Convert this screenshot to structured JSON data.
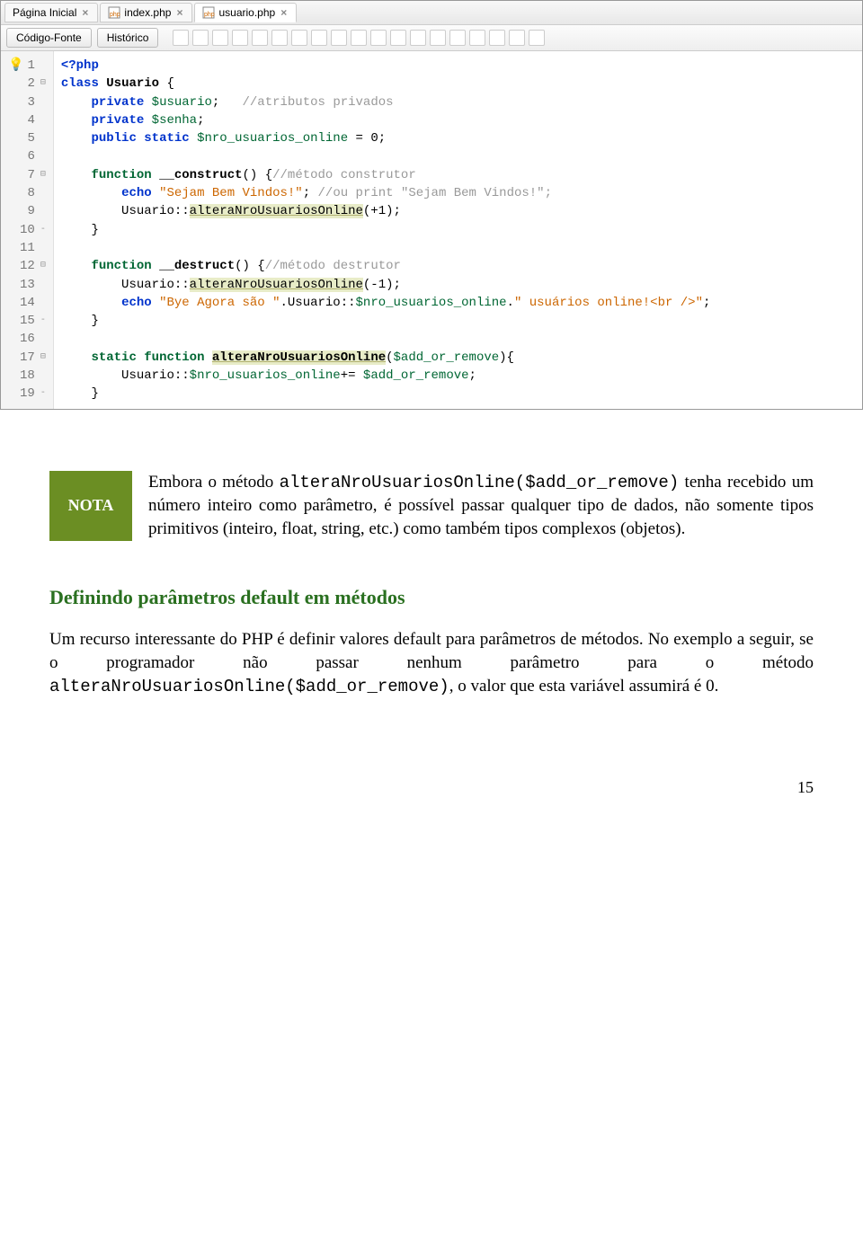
{
  "ide": {
    "tabs": [
      {
        "label": "Página Inicial"
      },
      {
        "label": "index.php"
      },
      {
        "label": "usuario.php"
      }
    ],
    "subtoolbar": {
      "source_btn": "Código-Fonte",
      "history_btn": "Histórico"
    },
    "code_lines": [
      {
        "n": 1,
        "bulb": true,
        "html": "<span class='kw'>&lt;?php</span>"
      },
      {
        "n": 2,
        "fold": "⊟",
        "html": "<span class='kw'>class</span> <span class='ident'>Usuario</span> {"
      },
      {
        "n": 3,
        "html": "    <span class='kw'>private</span> <span class='var'>$usuario</span>;   <span class='cmt'>//atributos privados</span>"
      },
      {
        "n": 4,
        "html": "    <span class='kw'>private</span> <span class='var'>$senha</span>;"
      },
      {
        "n": 5,
        "html": "    <span class='kw'>public static</span> <span class='var'>$nro_usuarios_online</span> = <span class='num'>0</span>;"
      },
      {
        "n": 6,
        "html": ""
      },
      {
        "n": 7,
        "fold": "⊟",
        "html": "    <span class='kw2'>function</span> <span class='ident'>__construct</span>() {<span class='cmt'>//método construtor</span>"
      },
      {
        "n": 8,
        "html": "        <span class='kw'>echo</span> <span class='str'>\"Sejam Bem Vindos!\"</span>; <span class='cmt'>//ou print \"Sejam Bem Vindos!\";</span>"
      },
      {
        "n": 9,
        "html": "        Usuario::<span class='hl underline'>alteraNroUsuariosOnline</span>(+<span class='num'>1</span>);"
      },
      {
        "n": 10,
        "fold": "-",
        "html": "    }"
      },
      {
        "n": 11,
        "html": ""
      },
      {
        "n": 12,
        "fold": "⊟",
        "html": "    <span class='kw2'>function</span> <span class='ident'>__destruct</span>() {<span class='cmt'>//método destrutor</span>"
      },
      {
        "n": 13,
        "html": "        Usuario::<span class='hl underline'>alteraNroUsuariosOnline</span>(-<span class='num'>1</span>);"
      },
      {
        "n": 14,
        "html": "        <span class='kw'>echo</span> <span class='str'>\"Bye Agora são \"</span>.Usuario::<span class='var'>$nro_usuarios_online</span>.<span class='str'>\" usuários online!&lt;br /&gt;\"</span>;"
      },
      {
        "n": 15,
        "fold": "-",
        "html": "    }"
      },
      {
        "n": 16,
        "html": ""
      },
      {
        "n": 17,
        "fold": "⊟",
        "html": "    <span class='kw2'>static function</span> <span class='ident hl underline'>alteraNroUsuariosOnline</span>(<span class='var'>$add_or_remove</span>){"
      },
      {
        "n": 18,
        "html": "        Usuario::<span class='var'>$nro_usuarios_online</span>+= <span class='var'>$add_or_remove</span>;"
      },
      {
        "n": 19,
        "fold": "-",
        "html": "    }"
      }
    ]
  },
  "nota": {
    "label": "NOTA",
    "text_prefix": "Embora o método ",
    "text_code": "alteraNroUsuariosOnline($add_or_remove)",
    "text_suffix": " tenha recebido um número inteiro como parâmetro, é possível passar qualquer tipo de dados, não somente tipos primitivos (inteiro, float, string, etc.) como também tipos complexos (objetos)."
  },
  "section": {
    "heading": "Definindo parâmetros default em métodos",
    "p1": "Um recurso interessante do PHP é definir valores default para parâmetros de métodos. No exemplo a seguir, se o programador não passar nenhum parâmetro para o método ",
    "p1_code": "alteraNroUsuariosOnline($add_or_remove)",
    "p1_suffix": ", o valor que esta variável assumirá é 0."
  },
  "page_number": "15"
}
